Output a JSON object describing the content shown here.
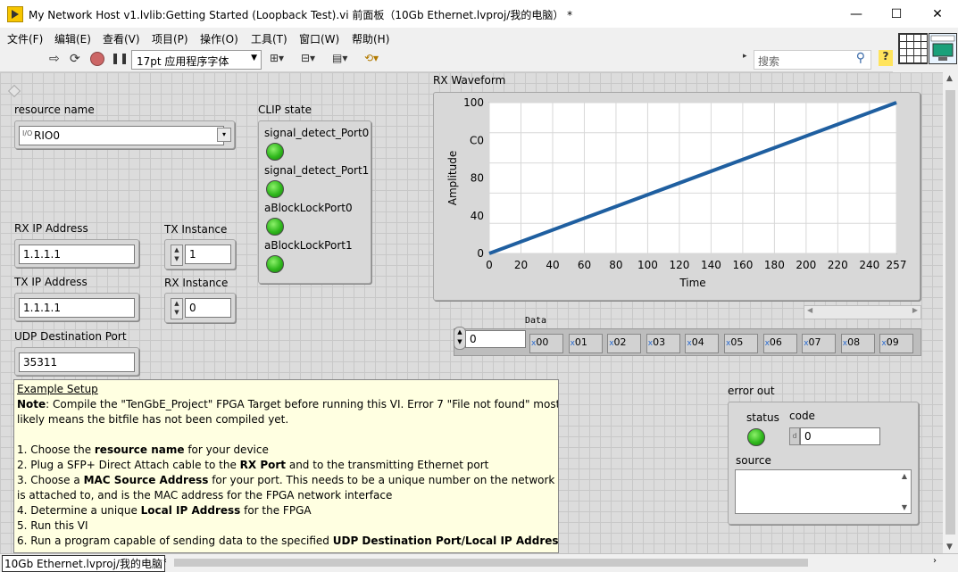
{
  "window": {
    "title": "My Network Host v1.lvlib:Getting Started (Loopback Test).vi 前面板（10Gb Ethernet.lvproj/我的电脑）  *",
    "minimize": "—",
    "maximize": "☐",
    "close": "✕"
  },
  "menu": [
    "文件(F)",
    "编辑(E)",
    "查看(V)",
    "项目(P)",
    "操作(O)",
    "工具(T)",
    "窗口(W)",
    "帮助(H)"
  ],
  "toolbar": {
    "font_select": "17pt 应用程序字体",
    "search_placeholder": "搜索",
    "help": "?"
  },
  "controls": {
    "resource_name": {
      "label": "resource name",
      "value": "RIO0"
    },
    "rx_ip": {
      "label": "RX IP Address",
      "value": "1.1.1.1"
    },
    "tx_ip": {
      "label": "TX IP Address",
      "value": "1.1.1.1"
    },
    "tx_instance": {
      "label": "TX Instance",
      "value": "1"
    },
    "rx_instance": {
      "label": "RX Instance",
      "value": "0"
    },
    "udp_port": {
      "label": "UDP Destination Port",
      "value": "35311"
    },
    "clip_state": {
      "label": "CLIP state",
      "items": [
        "signal_detect_Port0",
        "signal_detect_Port1",
        "aBlockLockPort0",
        "aBlockLockPort1"
      ]
    },
    "data_array": {
      "label": "Data",
      "index": "0",
      "cells": [
        "00",
        "01",
        "02",
        "03",
        "04",
        "05",
        "06",
        "07",
        "08",
        "09"
      ]
    },
    "error_out": {
      "label": "error out",
      "status_label": "status",
      "code_label": "code",
      "code_value": "0",
      "source_label": "source"
    }
  },
  "note": {
    "heading": "Example Setup",
    "line1_bold": "Note",
    "line1": ": Compile the \"TenGbE_Project\" FPGA Target before running this VI. Error 7 \"File not found\" most",
    "line2": "likely means the bitfile has not been compiled yet.",
    "s1a": "1. Choose the ",
    "s1b": "resource name",
    "s1c": " for your device",
    "s2a": "2. Plug a SFP+ Direct Attach cable to the ",
    "s2b": "RX Port",
    "s2c": " and to the transmitting Ethernet port",
    "s3a": "3. Choose a ",
    "s3b": "MAC Source Address",
    "s3c": " for your port.  This needs to be a unique number on the network this",
    "s3d": "is attached to, and is the MAC address for the FPGA network interface",
    "s4a": "4. Determine a unique ",
    "s4b": "Local IP Address",
    "s4c": " for the FPGA",
    "s5": "5. Run this VI",
    "s6a": "6. Run a program capable of sending data to the specified ",
    "s6b": "UDP Destination Port/Local IP Address"
  },
  "statusbar": {
    "project": "10Gb Ethernet.lvproj/我的电脑"
  },
  "chart_data": {
    "type": "line",
    "title": "RX Waveform",
    "xlabel": "Time",
    "ylabel": "Amplitude",
    "xlim": [
      0,
      257
    ],
    "ylim": [
      0,
      100
    ],
    "xticks": [
      "0",
      "20",
      "40",
      "60",
      "80",
      "100",
      "120",
      "140",
      "160",
      "180",
      "200",
      "220",
      "240",
      "257"
    ],
    "yticks": [
      "0",
      "20",
      "40",
      "60",
      "80",
      "C0",
      "100"
    ],
    "series": [
      {
        "x": [
          0,
          257
        ],
        "y": [
          0,
          100
        ]
      }
    ],
    "color": "#1f5fa0",
    "grid": true
  }
}
